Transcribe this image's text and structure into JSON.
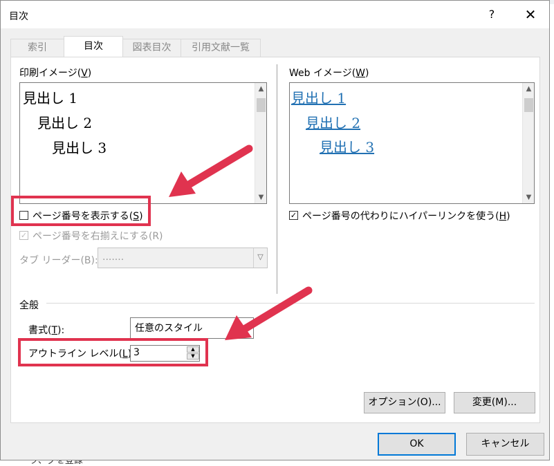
{
  "dialog": {
    "title": "目次",
    "help_label": "?",
    "close_label": "✕"
  },
  "tabs": [
    {
      "label": "索引",
      "active": false
    },
    {
      "label": "目次",
      "active": true
    },
    {
      "label": "図表目次",
      "active": false
    },
    {
      "label": "引用文献一覧",
      "active": false
    }
  ],
  "print_preview": {
    "label": "印刷イメージ(",
    "accel": "V",
    "label_end": ")",
    "lines": [
      "見出し 1",
      "見出し 2",
      "見出し 3"
    ]
  },
  "web_preview": {
    "label": "Web イメージ(",
    "accel": "W",
    "label_end": ")",
    "lines": [
      "見出し 1",
      "見出し 2",
      "見出し 3"
    ]
  },
  "options": {
    "show_page_numbers": {
      "label": "ページ番号を表示する(",
      "accel": "S",
      "label_end": ")",
      "checked": false
    },
    "right_align": {
      "label": "ページ番号を右揃えにする(R)",
      "checked": true
    },
    "tab_leader": {
      "label": "タブ リーダー(B):",
      "value": "......."
    },
    "hyperlinks": {
      "label": "ページ番号の代わりにハイパーリンクを使う(",
      "accel": "H",
      "label_end": ")",
      "checked": true
    }
  },
  "general": {
    "heading": "全般",
    "format_label": "書式(",
    "format_accel": "T",
    "format_label_end": "):",
    "format_value": "任意のスタイル",
    "outline_label": "アウトライン レベル(",
    "outline_accel": "L",
    "outline_label_end": "):",
    "outline_value": "3"
  },
  "buttons": {
    "options": "オプション(O)...",
    "modify": "変更(M)...",
    "ok": "OK",
    "cancel": "キャンセル"
  },
  "background_text": "ーク、グを登録"
}
